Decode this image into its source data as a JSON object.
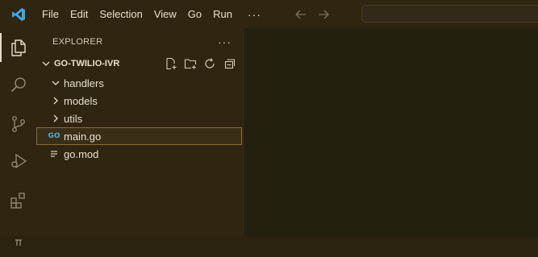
{
  "menu": {
    "items": [
      "File",
      "Edit",
      "Selection",
      "View",
      "Go",
      "Run"
    ],
    "more": "···"
  },
  "explorer": {
    "title": "EXPLORER",
    "more": "···",
    "folder": "GO-TWILIO-IVR",
    "tree": [
      {
        "label": "handlers",
        "type": "folder",
        "expanded": true
      },
      {
        "label": "models",
        "type": "folder",
        "expanded": false
      },
      {
        "label": "utils",
        "type": "folder",
        "expanded": false
      },
      {
        "label": "main.go",
        "type": "file",
        "icon": "go-file-icon",
        "icon_text": "GO",
        "selected": true
      },
      {
        "label": "go.mod",
        "type": "file",
        "icon": "lines-file-icon"
      }
    ]
  },
  "activity_icons": [
    "files-icon",
    "search-icon",
    "source-control-icon",
    "run-debug-icon",
    "extensions-icon",
    "testing-icon"
  ],
  "colors": {
    "background": "#2b2210",
    "sidebar": "#2f2511",
    "editor": "#24200f",
    "accent": "#8a6b3e",
    "logo": "#3ea6e6",
    "go": "#5aa7c8"
  }
}
